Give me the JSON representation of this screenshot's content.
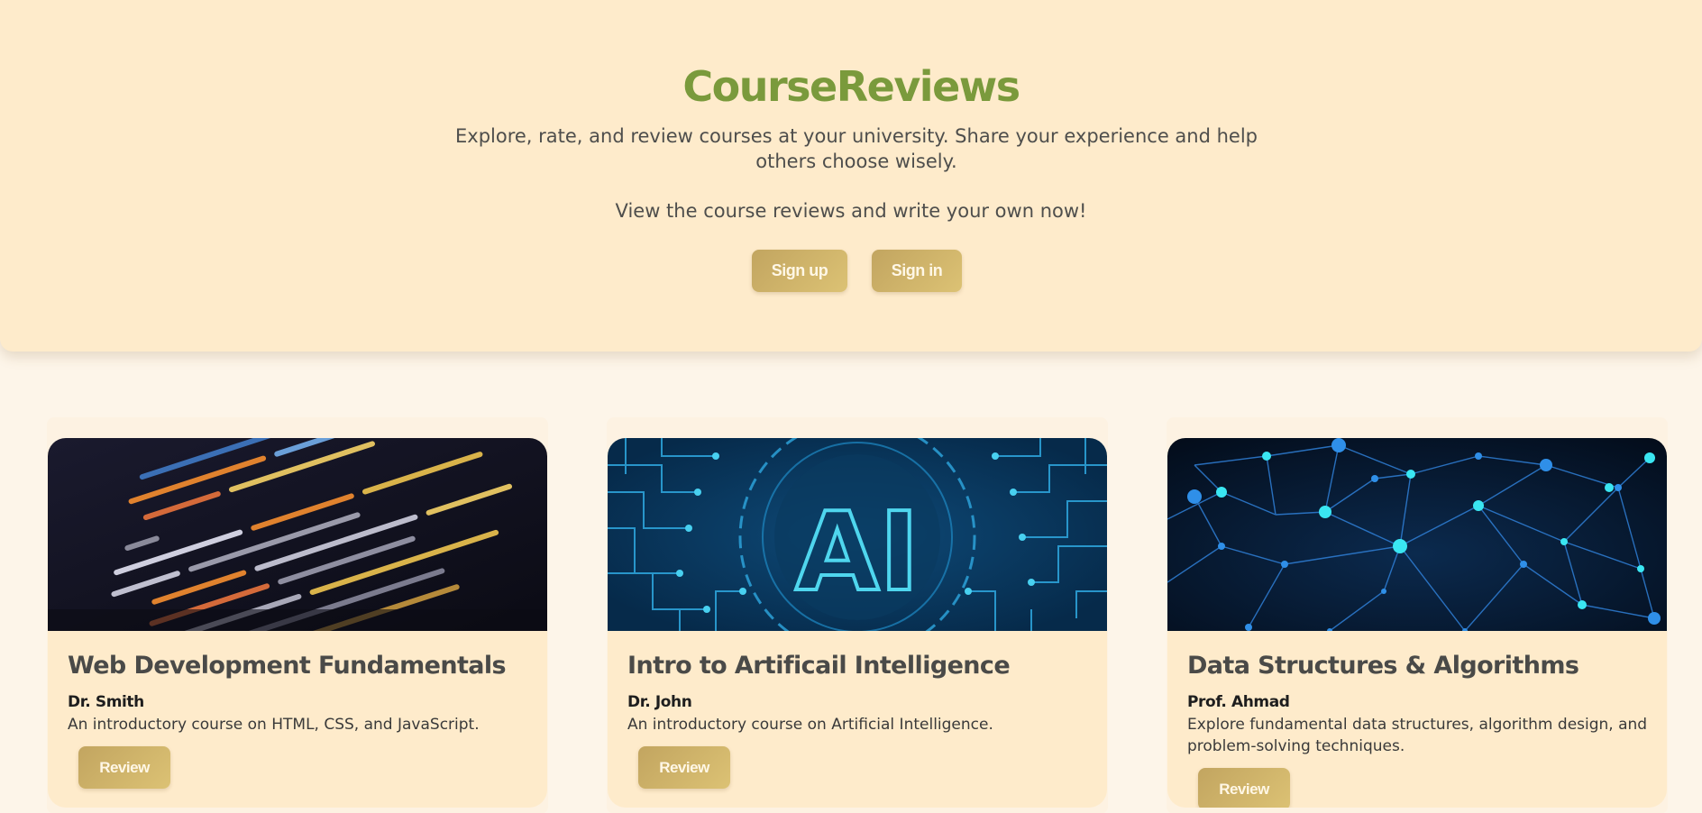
{
  "hero": {
    "brand": "CourseReviews",
    "tagline": "Explore, rate, and review courses at your university. Share your experience and help others choose wisely.",
    "subline": "View the course reviews and write your own now!",
    "signup_label": "Sign up",
    "signin_label": "Sign in"
  },
  "courses": [
    {
      "title": "Web Development Fundamentals",
      "professor": "Dr. Smith",
      "description": "An introductory course on HTML, CSS, and JavaScript.",
      "review_label": "Review",
      "image": "code-editor-image"
    },
    {
      "title": "Intro to Artificail Intelligence",
      "professor": "Dr. John",
      "description": "An introductory course on Artificial Intelligence.",
      "review_label": "Review",
      "image": "ai-circuit-image",
      "image_text": "AI"
    },
    {
      "title": "Data Structures & Algorithms",
      "professor": "Prof. Ahmad",
      "description": "Explore fundamental data structures, algorithm design, and problem-solving techniques.",
      "review_label": "Review",
      "image": "network-graph-image"
    }
  ],
  "colors": {
    "page_bg": "#fdf5e9",
    "hero_bg": "#feebcb",
    "brand": "#7a9a3c",
    "button": "#c9ad66",
    "button_text": "#fff7e6"
  }
}
